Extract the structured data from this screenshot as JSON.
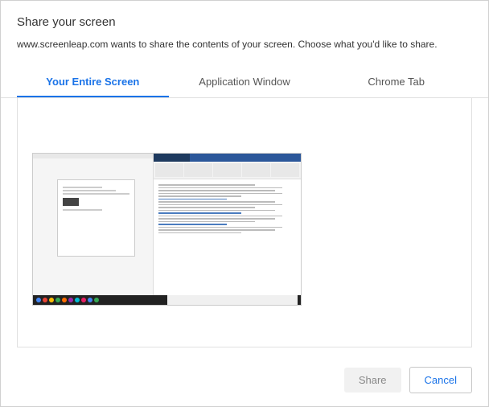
{
  "dialog": {
    "title": "Share your screen",
    "subtitle": "www.screenleap.com wants to share the contents of your screen. Choose what you'd like to share."
  },
  "tabs": [
    {
      "label": "Your Entire Screen",
      "active": true
    },
    {
      "label": "Application Window",
      "active": false
    },
    {
      "label": "Chrome Tab",
      "active": false
    }
  ],
  "footer": {
    "share_label": "Share",
    "cancel_label": "Cancel"
  }
}
